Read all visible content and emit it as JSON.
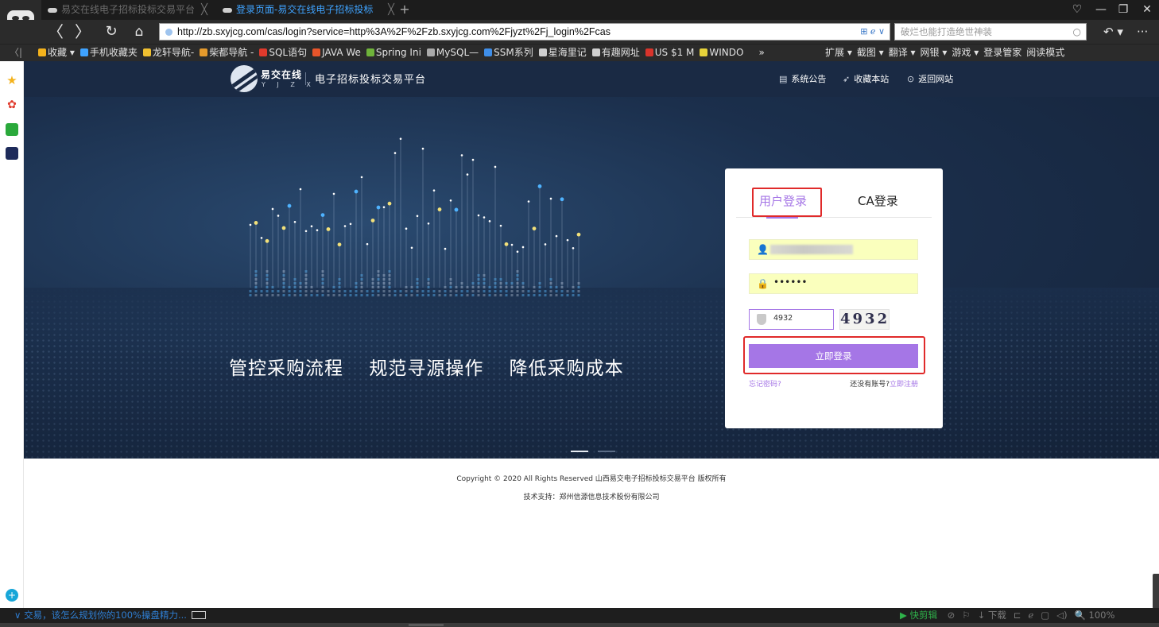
{
  "browser": {
    "tabs": [
      {
        "title": "易交在线电子招标投标交易平台",
        "active": false
      },
      {
        "title": "登录页面-易交在线电子招标投标",
        "active": true
      }
    ],
    "tab_close": "╳",
    "new_tab": "+",
    "window_controls": {
      "skin": "♡",
      "minimize": "—",
      "maximize": "❐",
      "close": "✕"
    },
    "nav": {
      "back": "〈",
      "forward": "〉",
      "reload": "↻",
      "home": "⌂"
    },
    "address_url": "http://zb.sxyjcg.com/cas/login?service=http%3A%2F%2Fzb.sxyjcg.com%2Fjyzt%2Fj_login%2Fcas",
    "address_tools": "⊞ ℯ ∨",
    "search_placeholder": "破烂也能打造绝世神装",
    "search_icon": "○",
    "undo": "↶ ▾",
    "more": "···",
    "bookmarks_left": "〈|",
    "bookmarks": [
      {
        "label": "收藏 ▾",
        "color": "#f4b21c"
      },
      {
        "label": "手机收藏夹",
        "color": "#3fa3ff"
      },
      {
        "label": "龙轩导航-",
        "color": "#f0c030"
      },
      {
        "label": "柴都导航 -",
        "color": "#e59a2c"
      },
      {
        "label": "SQL语句",
        "color": "#e03a2c"
      },
      {
        "label": "JAVA We",
        "color": "#e8552a"
      },
      {
        "label": "Spring Ini",
        "color": "#6fb33a"
      },
      {
        "label": "MySQL—",
        "color": "#aaaaaa"
      },
      {
        "label": "SSM系列",
        "color": "#3f8ee8"
      },
      {
        "label": "星海里记",
        "color": "#cfcfcf"
      },
      {
        "label": "有趣网址",
        "color": "#cfcfcf"
      },
      {
        "label": "US $1 M",
        "color": "#d9342b"
      },
      {
        "label": "WINDO",
        "color": "#e6d23a"
      },
      {
        "label": "»",
        "color": "transparent"
      }
    ],
    "bookmark_tools": [
      "扩展 ▾",
      "截图 ▾",
      "翻译 ▾",
      "网银 ▾",
      "游戏 ▾",
      "登录管家",
      "阅读模式"
    ]
  },
  "sidebar": {
    "items": [
      "star-icon",
      "weibo-icon",
      "mail-icon",
      "news-icon",
      "add-icon"
    ],
    "add": "+",
    "star": "★",
    "weibo": "✿"
  },
  "site": {
    "logo_cn": "易交在线",
    "logo_en": "Y J Z X",
    "platform_title": "电子招标投标交易平台",
    "nav": [
      {
        "icon": "▤",
        "label": "系统公告"
      },
      {
        "icon": "➶",
        "label": "收藏本站"
      },
      {
        "icon": "⊙",
        "label": "返回网站"
      }
    ],
    "slogans": [
      "管控采购流程",
      "规范寻源操作",
      "降低采购成本"
    ],
    "slider": {
      "count": 2,
      "active": 0
    }
  },
  "login": {
    "tabs": [
      "用户登录",
      "CA登录"
    ],
    "active_tab": 0,
    "username_icon": "👤",
    "password_icon": "🔒",
    "password_value": "••••••",
    "captcha_value": "4932",
    "captcha_image_text": "4932",
    "submit_label": "立即登录",
    "forgot_label": "忘记密码?",
    "register_prompt": "还没有账号?",
    "register_link": "立即注册"
  },
  "footer": {
    "copyright": "Copyright © 2020 All Rights Reserved 山西易交电子招标投标交易平台 版权所有",
    "support": "技术支持：郑州信源信息技术股份有限公司"
  },
  "statusbar": {
    "news": "∨ 交易，该怎么规划你的100%操盘精力...",
    "clip_label": "▶ 快剪辑",
    "items": [
      "⊘",
      "⚐",
      "↓ 下载",
      "⊏",
      "ℯ",
      "▢",
      "◁)",
      "🔍 100%"
    ]
  }
}
